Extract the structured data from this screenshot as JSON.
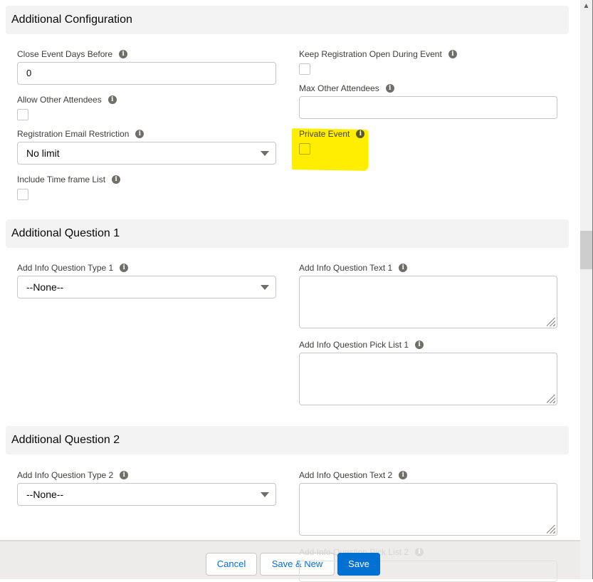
{
  "sections": {
    "additional_configuration": {
      "title": "Additional Configuration",
      "close_event_days_before": {
        "label": "Close Event Days Before",
        "value": "0"
      },
      "keep_registration_open": {
        "label": "Keep Registration Open During Event",
        "checked": false
      },
      "allow_other_attendees": {
        "label": "Allow Other Attendees",
        "checked": false
      },
      "max_other_attendees": {
        "label": "Max Other Attendees",
        "value": ""
      },
      "registration_email_restriction": {
        "label": "Registration Email Restriction",
        "selected": "No limit"
      },
      "private_event": {
        "label": "Private Event",
        "checked": false,
        "highlight_color": "#ffee00"
      },
      "include_time_frame_list": {
        "label": "Include Time frame List",
        "checked": false
      }
    },
    "additional_question_1": {
      "title": "Additional Question 1",
      "question_type": {
        "label": "Add Info Question Type 1",
        "selected": "--None--"
      },
      "question_text": {
        "label": "Add Info Question Text 1",
        "value": ""
      },
      "question_pick_list": {
        "label": "Add Info Question Pick List 1",
        "value": ""
      }
    },
    "additional_question_2": {
      "title": "Additional Question 2",
      "question_type": {
        "label": "Add Info Question Type 2",
        "selected": "--None--"
      },
      "question_text": {
        "label": "Add Info Question Text 2",
        "value": ""
      },
      "question_pick_list": {
        "label": "Add Info Question Pick List 2",
        "value": ""
      }
    }
  },
  "icons": {
    "info": "i",
    "scroll_up": "▲"
  },
  "footer": {
    "cancel_label": "Cancel",
    "save_new_label": "Save & New",
    "save_label": "Save"
  },
  "colors": {
    "brand": "#0070d2",
    "section_bg": "#f3f3f3",
    "highlight": "#ffee00"
  }
}
